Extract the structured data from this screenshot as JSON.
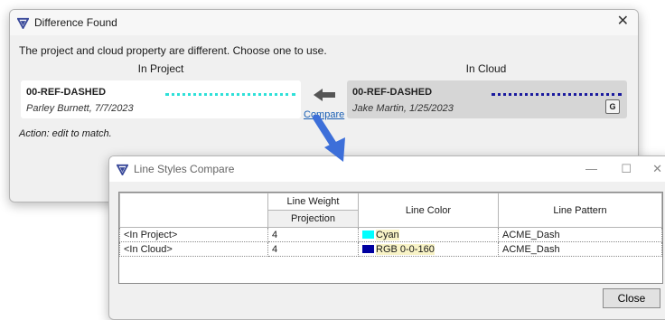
{
  "main_dialog": {
    "title": "Difference Found",
    "close_glyph": "✕",
    "message": "The project and cloud property are different. Choose one to use.",
    "in_project_label": "In Project",
    "in_cloud_label": "In Cloud",
    "project_card": {
      "name": "00-REF-DASHED",
      "author": "Parley Burnett, 7/7/2023",
      "dot_color": "#2ee0d8"
    },
    "cloud_card": {
      "name": "00-REF-DASHED",
      "author": "Jake Martin, 1/25/2023",
      "dot_color": "#1a1a9e",
      "badge": "G"
    },
    "compare_link": "Compare",
    "action_text": "Action: edit to match."
  },
  "compare_window": {
    "title": "Line Styles Compare",
    "minimize_glyph": "—",
    "maximize_glyph": "☐",
    "close_glyph": "✕",
    "columns": {
      "name": "",
      "line_weight": "Line Weight",
      "projection": "Projection",
      "line_color": "Line Color",
      "line_pattern": "Line Pattern"
    },
    "rows": [
      {
        "label": "<In Project>",
        "weight": "4",
        "color_name": "Cyan",
        "color_hex": "#00ffff",
        "pattern": "ACME_Dash"
      },
      {
        "label": "<In Cloud>",
        "weight": "4",
        "color_name": "RGB 0-0-160",
        "color_hex": "#0000a0",
        "pattern": "ACME_Dash"
      }
    ],
    "close_button": "Close"
  },
  "colors": {
    "accent_logo": "#3a4a9a",
    "highlight_blue": "#3d6fd9"
  }
}
